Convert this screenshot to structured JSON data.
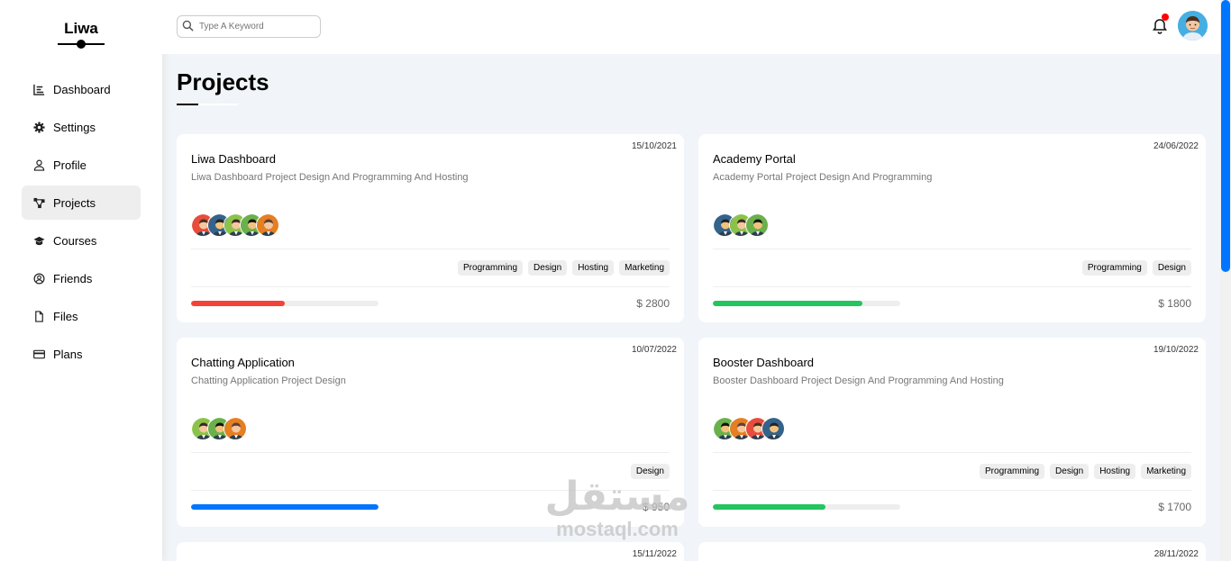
{
  "sidebar": {
    "logo": "Liwa",
    "items": [
      {
        "label": "Dashboard",
        "icon": "chart-icon"
      },
      {
        "label": "Settings",
        "icon": "gear-icon"
      },
      {
        "label": "Profile",
        "icon": "user-icon"
      },
      {
        "label": "Projects",
        "icon": "diagram-icon",
        "active": true
      },
      {
        "label": "Courses",
        "icon": "graduation-cap-icon"
      },
      {
        "label": "Friends",
        "icon": "user-circle-icon"
      },
      {
        "label": "Files",
        "icon": "file-icon"
      },
      {
        "label": "Plans",
        "icon": "credit-card-icon"
      }
    ]
  },
  "header": {
    "search_placeholder": "Type A Keyword",
    "notification_badge_color": "#ff0000",
    "accent": "#0075ff"
  },
  "page": {
    "title": "Projects"
  },
  "projects": [
    {
      "date": "15/10/2021",
      "name": "Liwa Dashboard",
      "desc": "Liwa Dashboard Project Design And Programming And Hosting",
      "team_count": 5,
      "tags": [
        "Programming",
        "Design",
        "Hosting",
        "Marketing"
      ],
      "progress": 0.5,
      "progress_color": "#f44336",
      "price": "$ 2800"
    },
    {
      "date": "24/06/2022",
      "name": "Academy Portal",
      "desc": "Academy Portal Project Design And Programming",
      "team_count": 3,
      "tags": [
        "Programming",
        "Design"
      ],
      "progress": 0.8,
      "progress_color": "#22c55e",
      "price": "$ 1800"
    },
    {
      "date": "10/07/2022",
      "name": "Chatting Application",
      "desc": "Chatting Application Project Design",
      "team_count": 3,
      "tags": [
        "Design"
      ],
      "progress": 1.0,
      "progress_color": "#0075ff",
      "price": "$ 950"
    },
    {
      "date": "19/10/2022",
      "name": "Booster Dashboard",
      "desc": "Booster Dashboard Project Design And Programming And Hosting",
      "team_count": 4,
      "tags": [
        "Programming",
        "Design",
        "Hosting",
        "Marketing"
      ],
      "progress": 0.6,
      "progress_color": "#22c55e",
      "price": "$ 1700"
    },
    {
      "date": "15/11/2022"
    },
    {
      "date": "28/11/2022"
    }
  ],
  "watermark": {
    "arabic": "مستقل",
    "latin": "mostaql.com"
  }
}
